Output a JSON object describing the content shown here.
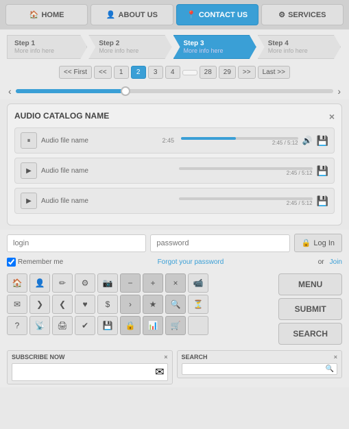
{
  "nav": {
    "items": [
      {
        "id": "home",
        "label": "HOME",
        "icon": "🏠",
        "active": false
      },
      {
        "id": "about",
        "label": "ABOUT US",
        "icon": "👤",
        "active": false
      },
      {
        "id": "contact",
        "label": "CONTACT US",
        "icon": "📍",
        "active": true
      },
      {
        "id": "services",
        "label": "SERVICES",
        "icon": "⚙",
        "active": false
      }
    ]
  },
  "steps": [
    {
      "label": "Step 1",
      "sub": "More info here",
      "active": false
    },
    {
      "label": "Step 2",
      "sub": "More info here",
      "active": false
    },
    {
      "label": "Step 3",
      "sub": "More info here",
      "active": true
    },
    {
      "label": "Step 4",
      "sub": "More info here",
      "active": false
    }
  ],
  "pagination": {
    "first": "<< First",
    "prev_double": "<<",
    "pages": [
      "1",
      "2",
      "3",
      "4",
      "",
      "28",
      "29"
    ],
    "active_page": "2",
    "next_double": ">>",
    "last": "Last >>"
  },
  "audio": {
    "title": "AUDIO CATALOG NAME",
    "close": "×",
    "tracks": [
      {
        "name": "Audio file name",
        "time": "2:45",
        "total": "5:12",
        "playing": true,
        "progress": 47
      },
      {
        "name": "Audio file name",
        "time": "2:45",
        "total": "5:12",
        "playing": false,
        "progress": 0
      },
      {
        "name": "Audio file name",
        "time": "2:45",
        "total": "5:12",
        "playing": false,
        "progress": 0
      }
    ]
  },
  "login": {
    "login_placeholder": "login",
    "password_placeholder": "password",
    "login_button": "Log In",
    "lock_icon": "🔒",
    "or_text": "or",
    "join_text": "Join",
    "remember_label": "Remember me",
    "forgot_text": "Forgot your password"
  },
  "icons": {
    "rows": [
      [
        "🏠",
        "👤",
        "✏",
        "⚙",
        "📷",
        "−",
        "+",
        "×",
        "📹"
      ],
      [
        "✉",
        "❯",
        "❮",
        "♥",
        "$",
        "❯",
        "★",
        "🔍",
        "⏳"
      ],
      [
        "?",
        "📡",
        "🖨",
        "✔",
        "💾",
        "🔒",
        "📊",
        "🛒",
        ""
      ]
    ]
  },
  "right_buttons": [
    {
      "id": "menu-button",
      "label": "MENU"
    },
    {
      "id": "submit-button",
      "label": "SUBMIT"
    },
    {
      "id": "search-button",
      "label": "SEARCH"
    }
  ],
  "bottom": {
    "subscribe": {
      "title": "SUBSCRIBE NOW",
      "close": "×",
      "placeholder": "✉"
    },
    "search": {
      "title": "SEARCH",
      "close": "×",
      "placeholder": ""
    }
  }
}
